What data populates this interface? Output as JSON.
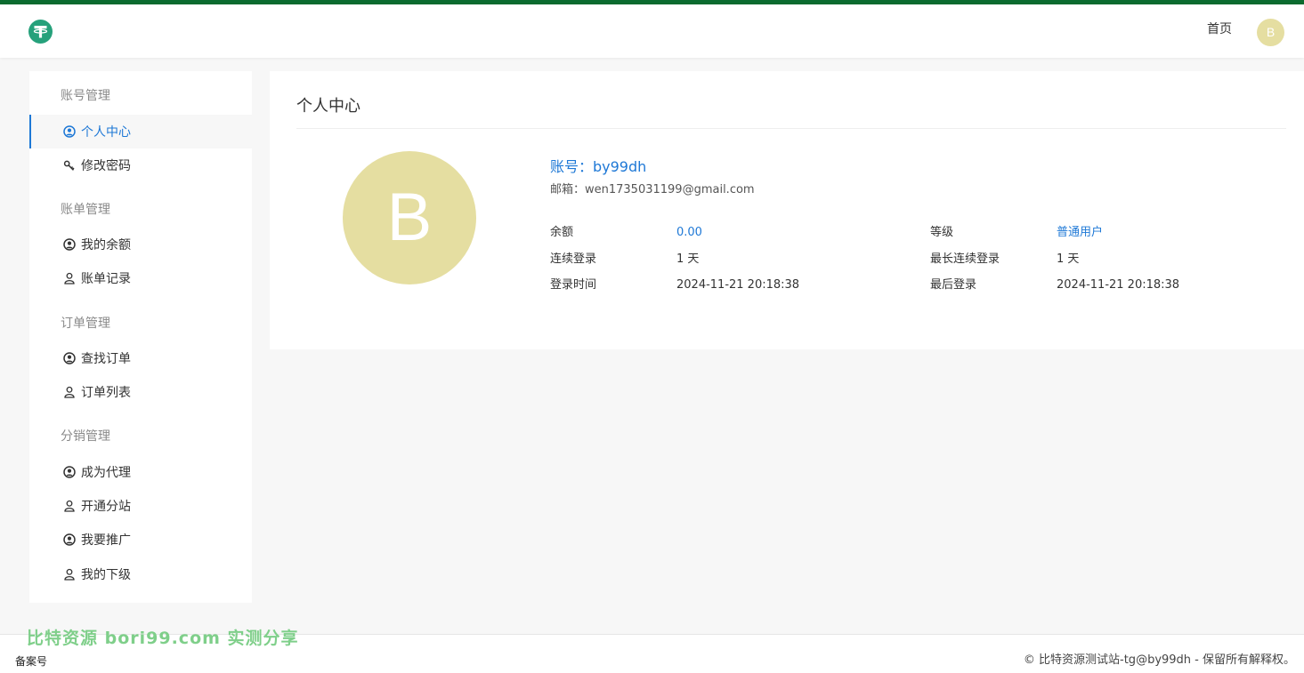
{
  "header": {
    "logo_icon": "tether-logo-icon",
    "nav_home": "首页",
    "avatar_letter": "B"
  },
  "sidebar": {
    "groups": [
      {
        "title": "账号管理",
        "items": [
          {
            "label": "个人中心",
            "icon": "user-circle-icon",
            "active": true
          },
          {
            "label": "修改密码",
            "icon": "key-icon"
          }
        ]
      },
      {
        "title": "账单管理",
        "items": [
          {
            "label": "我的余额",
            "icon": "user-circle-icon"
          },
          {
            "label": "账单记录",
            "icon": "user-outline-icon"
          }
        ]
      },
      {
        "title": "订单管理",
        "items": [
          {
            "label": "查找订单",
            "icon": "user-circle-icon"
          },
          {
            "label": "订单列表",
            "icon": "user-outline-icon"
          }
        ]
      },
      {
        "title": "分销管理",
        "items": [
          {
            "label": "成为代理",
            "icon": "user-circle-icon"
          },
          {
            "label": "开通分站",
            "icon": "user-outline-icon"
          },
          {
            "label": "我要推广",
            "icon": "user-circle-icon"
          },
          {
            "label": "我的下级",
            "icon": "user-outline-icon"
          }
        ]
      }
    ]
  },
  "profile": {
    "title": "个人中心",
    "avatar_letter": "B",
    "account": "账号：by99dh",
    "email": "邮箱：wen1735031199@gmail.com",
    "fields": {
      "balance_label": "余额",
      "balance_value": "0.00",
      "level_label": "等级",
      "level_value": "普通用户",
      "streak_label": "连续登录",
      "streak_value": "1 天",
      "max_streak_label": "最长连续登录",
      "max_streak_value": "1 天",
      "login_time_label": "登录时间",
      "login_time_value": "2024-11-21 20:18:38",
      "last_login_label": "最后登录",
      "last_login_value": "2024-11-21 20:18:38"
    }
  },
  "footer": {
    "watermark": "比特资源 bori99.com 实测分享",
    "beian": "备案号",
    "copyright": "© 比特资源测试站-tg@by99dh - 保留所有解释权。"
  },
  "colors": {
    "accent": "#1e78d6",
    "top_bar": "#0b6b2f",
    "avatar_bg": "#e5dea1"
  }
}
